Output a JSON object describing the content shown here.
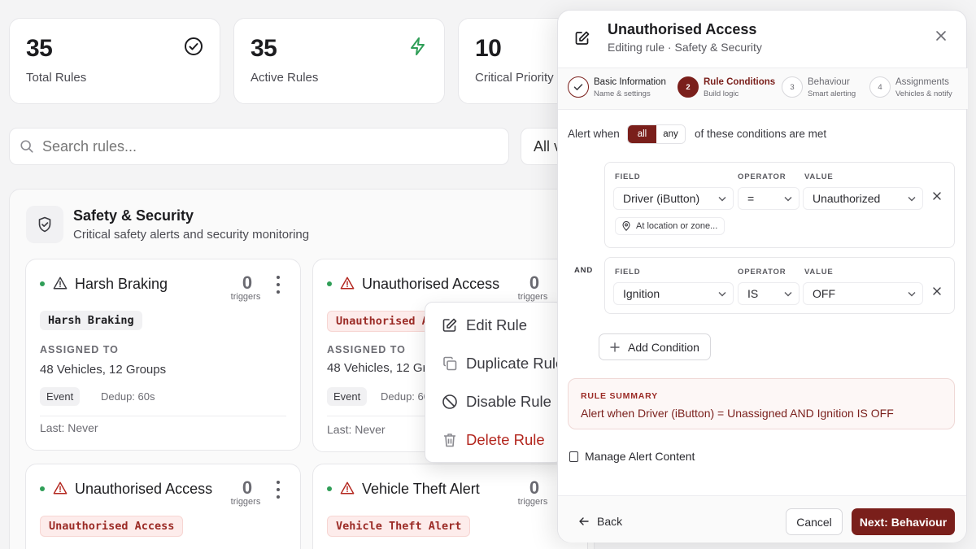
{
  "stats": [
    {
      "value": "35",
      "label": "Total Rules",
      "icon": "check-circle-icon"
    },
    {
      "value": "35",
      "label": "Active Rules",
      "icon": "lightning-icon"
    },
    {
      "value": "10",
      "label": "Critical Priority"
    }
  ],
  "search": {
    "placeholder": "Search rules..."
  },
  "filter": {
    "label": "All v"
  },
  "section": {
    "title": "Safety & Security",
    "subtitle": "Critical safety alerts and security monitoring"
  },
  "rules": [
    {
      "title": "Harsh Braking",
      "count": "0",
      "triggers": "triggers",
      "tag": "Harsh Braking",
      "assigned_label": "ASSIGNED TO",
      "assigned": "48 Vehicles, 12 Groups",
      "type": "Event",
      "dedup": "Dedup: 60s",
      "last": "Last: Never"
    },
    {
      "title": "Unauthorised Access",
      "count": "0",
      "triggers": "triggers",
      "tag": "Unauthorised A",
      "assigned_label": "ASSIGNED TO",
      "assigned": "48 Vehicles, 12 Gr",
      "type": "Event",
      "dedup": "Dedup: 60",
      "last": "Last: Never"
    },
    {
      "title": "Unauthorised Access",
      "count": "0",
      "triggers": "triggers",
      "tag": "Unauthorised Access"
    },
    {
      "title": "Vehicle Theft Alert",
      "count": "0",
      "triggers": "triggers",
      "tag": "Vehicle Theft Alert"
    }
  ],
  "context_menu": {
    "edit": "Edit Rule",
    "duplicate": "Duplicate Rule",
    "disable": "Disable Rule",
    "delete": "Delete Rule"
  },
  "panel": {
    "title": "Unauthorised Access",
    "subtitle": "Editing rule · Safety & Security",
    "steps": [
      {
        "num": "",
        "title": "Basic Information",
        "sub": "Name & settings",
        "state": "done"
      },
      {
        "num": "2",
        "title": "Rule Conditions",
        "sub": "Build logic",
        "state": "active"
      },
      {
        "num": "3",
        "title": "Behaviour",
        "sub": "Smart alerting",
        "state": "pending"
      },
      {
        "num": "4",
        "title": "Assignments",
        "sub": "Vehicles & notify",
        "state": "pending"
      }
    ],
    "alert_when": "Alert when",
    "match_all": "all",
    "match_any": "any",
    "of_these": "of these conditions are met",
    "field_label": "FIELD",
    "operator_label": "OPERATOR",
    "value_label": "VALUE",
    "and_label": "AND",
    "conditions": [
      {
        "field": "Driver (iButton)",
        "operator": "=",
        "value": "Unauthorized",
        "location": "At location or zone..."
      },
      {
        "field": "Ignition",
        "operator": "IS",
        "value": "OFF"
      }
    ],
    "add_condition": "Add Condition",
    "summary_label": "RULE SUMMARY",
    "summary": "Alert when Driver (iButton) = Unassigned AND Ignition IS OFF",
    "manage_content": "Manage Alert Content",
    "back": "Back",
    "cancel": "Cancel",
    "next": "Next: Behaviour"
  },
  "colors": {
    "accent": "#7a1f1b",
    "status_dot": "#2f9e57",
    "warning_icon": "#b3261e"
  }
}
